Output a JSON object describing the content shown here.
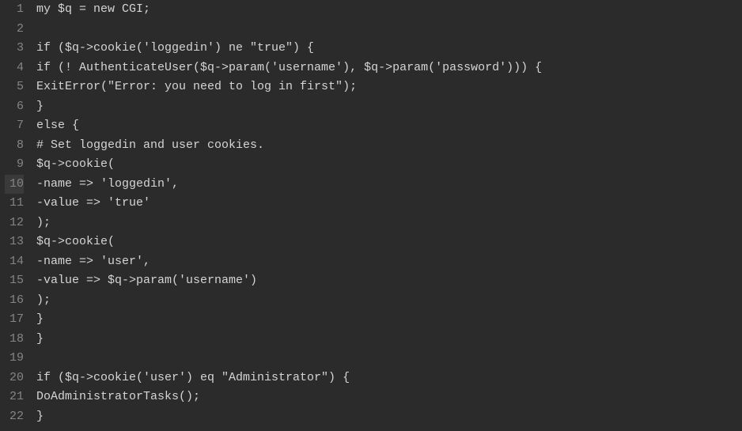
{
  "lines": [
    {
      "n": 1,
      "text": "my $q = new CGI;"
    },
    {
      "n": 2,
      "text": ""
    },
    {
      "n": 3,
      "text": "if ($q->cookie('loggedin') ne \"true\") {"
    },
    {
      "n": 4,
      "text": "if (! AuthenticateUser($q->param('username'), $q->param('password'))) {"
    },
    {
      "n": 5,
      "text": "ExitError(\"Error: you need to log in first\");"
    },
    {
      "n": 6,
      "text": "}"
    },
    {
      "n": 7,
      "text": "else {"
    },
    {
      "n": 8,
      "text": "# Set loggedin and user cookies."
    },
    {
      "n": 9,
      "text": "$q->cookie("
    },
    {
      "n": 10,
      "text": "-name => 'loggedin',"
    },
    {
      "n": 11,
      "text": "-value => 'true'"
    },
    {
      "n": 12,
      "text": ");"
    },
    {
      "n": 13,
      "text": "$q->cookie("
    },
    {
      "n": 14,
      "text": "-name => 'user',"
    },
    {
      "n": 15,
      "text": "-value => $q->param('username')"
    },
    {
      "n": 16,
      "text": ");"
    },
    {
      "n": 17,
      "text": "}"
    },
    {
      "n": 18,
      "text": "}"
    },
    {
      "n": 19,
      "text": ""
    },
    {
      "n": 20,
      "text": "if ($q->cookie('user') eq \"Administrator\") {"
    },
    {
      "n": 21,
      "text": "DoAdministratorTasks();"
    },
    {
      "n": 22,
      "text": "}"
    }
  ],
  "highlighted_line": 10
}
